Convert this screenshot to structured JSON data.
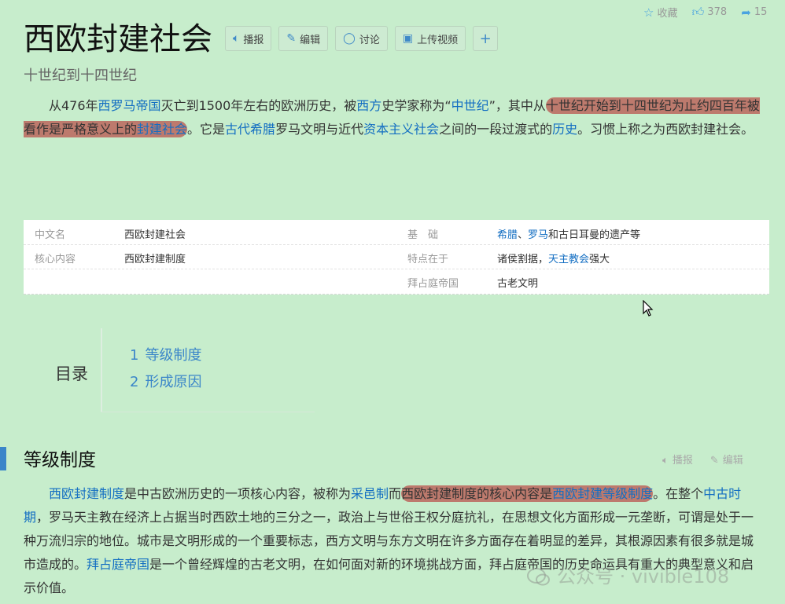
{
  "top_stats": {
    "collect": "收藏",
    "likes": "378",
    "share": "15"
  },
  "title": "西欧封建社会",
  "toolbar": {
    "play": "播报",
    "edit": "编辑",
    "discuss": "讨论",
    "upload": "上传视频",
    "add": "+"
  },
  "subtitle": "十世纪到十四世纪",
  "para1": {
    "t1": "从476年",
    "l1": "西罗马帝国",
    "t2": "灭亡到1500年左右的欧洲历史，被",
    "l2": "西方",
    "t3": "史学家称为“",
    "l3": "中世纪",
    "t4": "”，其中从",
    "h1": "十世纪开始到十四世纪为止约四百年被看作是严格意义上的",
    "hl1": "封建社会",
    "t5": "。它是",
    "l4": "古代希腊",
    "t6": "罗马文明与近代",
    "l5": "资本主义社会",
    "t7": "之间的一段过渡式的",
    "l6": "历史",
    "t8": "。习惯上称之为西欧封建社会。"
  },
  "infobox": {
    "rows": [
      {
        "k1": "中文名",
        "v1": "西欧封建社会",
        "k2": "基　础",
        "v2_link1": "希腊",
        "v2_sep": "、",
        "v2_link2": "罗马",
        "v2_text": "和古日耳曼的遗产等"
      },
      {
        "k1": "核心内容",
        "v1": "西欧封建制度",
        "k2": "特点在于",
        "v2_text1": "诸侯割据，",
        "v2_link": "天主教会",
        "v2_text2": "强大"
      },
      {
        "k1": "",
        "v1": "",
        "k2": "拜占庭帝国",
        "v2": "古老文明"
      }
    ]
  },
  "toc": {
    "title": "目录",
    "items": [
      {
        "num": "1",
        "label": "等级制度"
      },
      {
        "num": "2",
        "label": "形成原因"
      }
    ]
  },
  "section": {
    "title": "等级制度",
    "play": "播报",
    "edit": "编辑"
  },
  "para2": {
    "l1": "西欧封建制度",
    "t1": "是中古欧洲历史的一项核心内容，被称为",
    "l2": "采邑制",
    "t2": "而",
    "h1": "西欧封建制度的核心内容是",
    "hl1": "西欧封建等级制度",
    "t3": "。在整个",
    "l3": "中古时期",
    "t4": "，罗马天主教在经济上占据当时西欧土地的三分之一，政治上与世俗王权分庭抗礼，在思想文化方面形成一元垄断，可谓是处于一种万流归宗的地位。城市是文明形成的一个重要标志，西方文明与东方文明在许多方面存在着明显的差异，其根源因素有很多就是城市造成的。",
    "l4": "拜占庭帝国",
    "t5": "是一个曾经辉煌的古老文明，在如何面对新的环境挑战方面，拜占庭帝国的历史命运具有重大的典型意义和启示价值。"
  },
  "watermark": "公众号 · vivible108",
  "colors": {
    "background": "#c7edcc",
    "link": "#136ec2",
    "highlight": "#ba4e48",
    "accent": "#3b86c9"
  }
}
